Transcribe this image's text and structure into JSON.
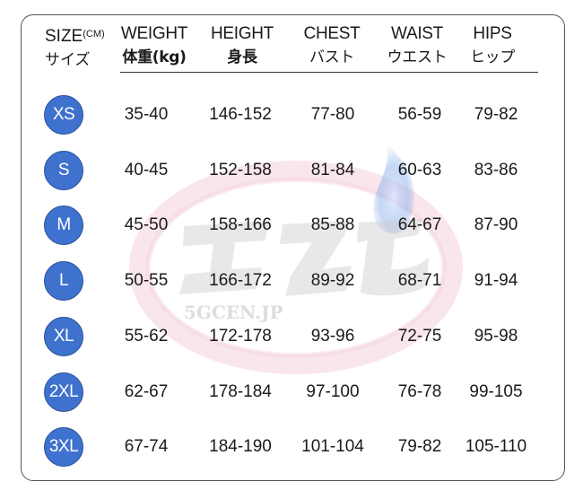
{
  "headers": {
    "size": {
      "en": "SIZE",
      "unit": "(CM)",
      "jp": "サイズ"
    },
    "weight": {
      "en": "WEIGHT",
      "jp": "体重(kg)"
    },
    "height": {
      "en": "HEIGHT",
      "jp": "身長"
    },
    "chest": {
      "en": "CHEST",
      "jp": "バスト"
    },
    "waist": {
      "en": "WAIST",
      "jp": "ウエスト"
    },
    "hips": {
      "en": "HIPS",
      "jp": "ヒップ"
    }
  },
  "rows": [
    {
      "size": "XS",
      "weight": "35-40",
      "height": "146-152",
      "chest": "77-80",
      "waist": "56-59",
      "hips": "79-82"
    },
    {
      "size": "S",
      "weight": "40-45",
      "height": "152-158",
      "chest": "81-84",
      "waist": "60-63",
      "hips": "83-86"
    },
    {
      "size": "M",
      "weight": "45-50",
      "height": "158-166",
      "chest": "85-88",
      "waist": "64-67",
      "hips": "87-90"
    },
    {
      "size": "L",
      "weight": "50-55",
      "height": "166-172",
      "chest": "89-92",
      "waist": "68-71",
      "hips": "91-94"
    },
    {
      "size": "XL",
      "weight": "55-62",
      "height": "172-178",
      "chest": "93-96",
      "waist": "72-75",
      "hips": "95-98"
    },
    {
      "size": "2XL",
      "weight": "62-67",
      "height": "178-184",
      "chest": "97-100",
      "waist": "76-78",
      "hips": "99-105"
    },
    {
      "size": "3XL",
      "weight": "67-74",
      "height": "184-190",
      "chest": "101-104",
      "waist": "79-82",
      "hips": "105-110"
    }
  ],
  "watermark": {
    "text": "5GCEN.JP"
  },
  "colors": {
    "badge": "#3f72cf",
    "watermark_pink": "#e7a7bb",
    "watermark_blue": "#7fa6e6"
  }
}
